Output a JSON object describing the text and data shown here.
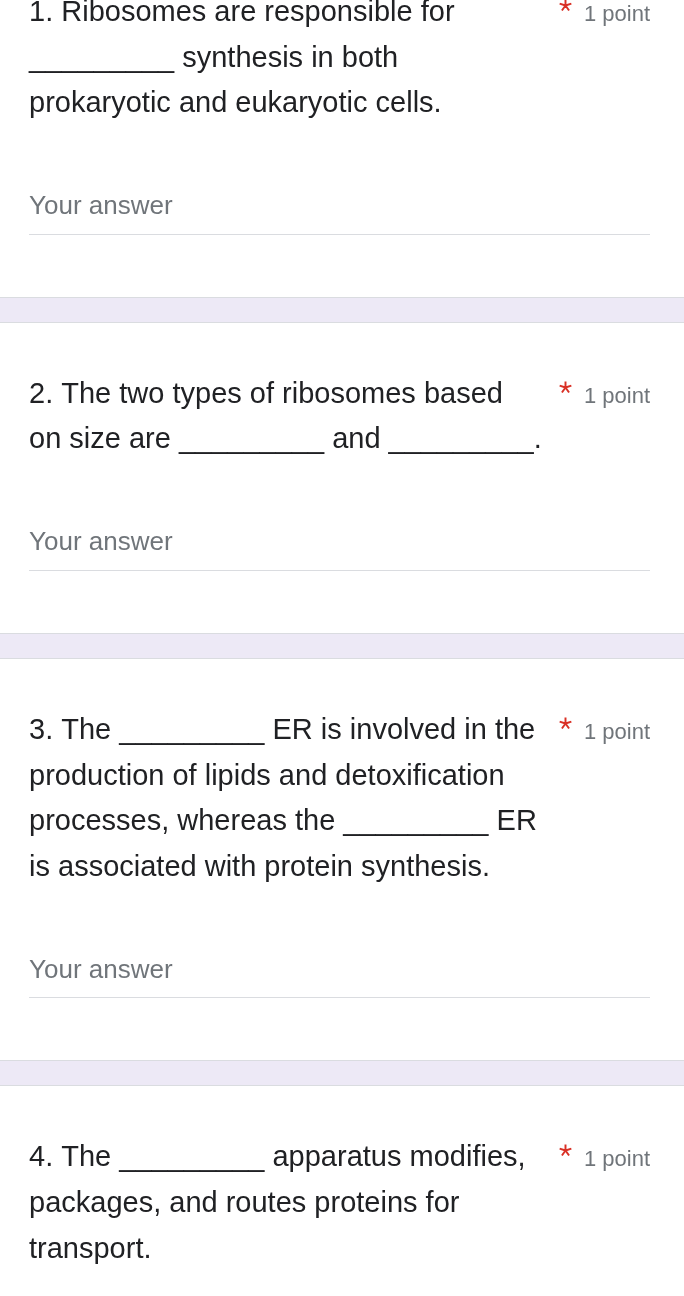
{
  "questions": [
    {
      "title": "1. Ribosomes are responsible for _________ synthesis in both prokaryotic and eukaryotic cells.",
      "required": true,
      "points": "1 point",
      "answer": {
        "placeholder": "Your answer"
      }
    },
    {
      "title": "2. The two types of ribosomes based on size are _________ and _________.",
      "required": true,
      "points": "1 point",
      "answer": {
        "placeholder": "Your answer"
      }
    },
    {
      "title": "3. The _________ ER is involved in the production of lipids and detoxification processes, whereas the _________ ER is associated with protein synthesis.",
      "required": true,
      "points": "1 point",
      "answer": {
        "placeholder": "Your answer"
      }
    },
    {
      "title": "4. The _________ apparatus modifies, packages, and routes proteins for transport.",
      "required": true,
      "points": "1 point"
    }
  ]
}
